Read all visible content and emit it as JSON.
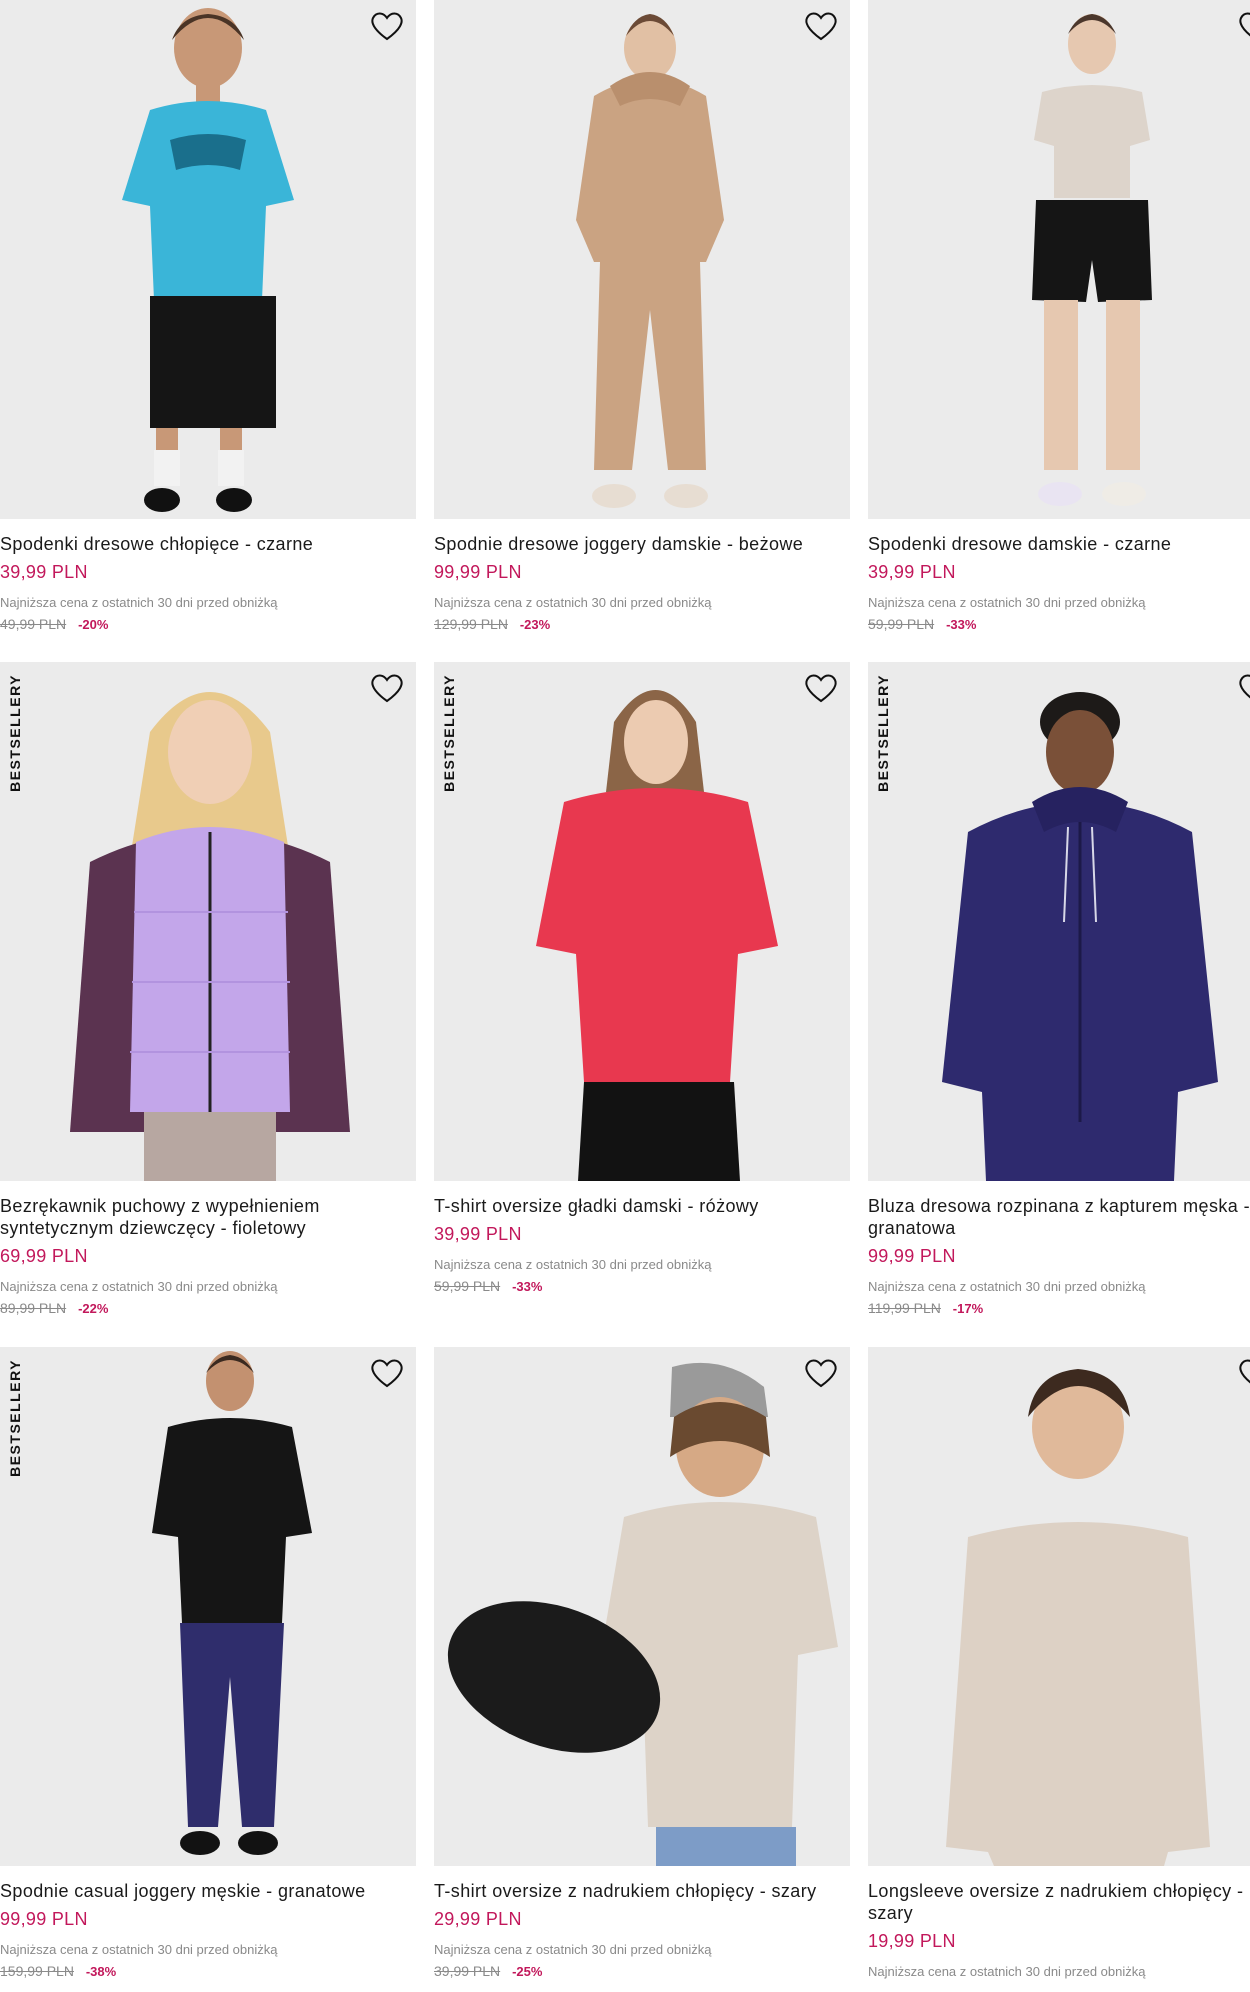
{
  "labels": {
    "lowest_price_note": "Najniższa cena z ostatnich 30 dni przed obniżką",
    "bestseller": "BESTSELLERY"
  },
  "colors": {
    "price": "#c2185b",
    "photo_bg": "#ebebeb"
  },
  "products": [
    {
      "name": "Spodenki dresowe chłopięce - czarne",
      "price": "39,99 PLN",
      "old_price": "49,99 PLN",
      "discount": "-20%",
      "bestseller": false,
      "wishlist_icon": "heart-outline-icon"
    },
    {
      "name": "Spodnie dresowe joggery damskie - beżowe",
      "price": "99,99 PLN",
      "old_price": "129,99 PLN",
      "discount": "-23%",
      "bestseller": false,
      "wishlist_icon": "heart-outline-icon"
    },
    {
      "name": "Spodenki dresowe damskie - czarne",
      "price": "39,99 PLN",
      "old_price": "59,99 PLN",
      "discount": "-33%",
      "bestseller": false,
      "wishlist_icon": "heart-outline-icon"
    },
    {
      "name": "Bezrękawnik puchowy z wypełnieniem syntetycznym dziewczęcy - fioletowy",
      "price": "69,99 PLN",
      "old_price": "89,99 PLN",
      "discount": "-22%",
      "bestseller": true,
      "wishlist_icon": "heart-outline-icon"
    },
    {
      "name": "T-shirt oversize gładki damski - różowy",
      "price": "39,99 PLN",
      "old_price": "59,99 PLN",
      "discount": "-33%",
      "bestseller": true,
      "wishlist_icon": "heart-outline-icon"
    },
    {
      "name": "Bluza dresowa rozpinana z kapturem męska - granatowa",
      "price": "99,99 PLN",
      "old_price": "119,99 PLN",
      "discount": "-17%",
      "bestseller": true,
      "wishlist_icon": "heart-outline-icon"
    },
    {
      "name": "Spodnie casual joggery męskie - granatowe",
      "price": "99,99 PLN",
      "old_price": "159,99 PLN",
      "discount": "-38%",
      "bestseller": true,
      "wishlist_icon": "heart-outline-icon"
    },
    {
      "name": "T-shirt oversize z nadrukiem chłopięcy - szary",
      "price": "29,99 PLN",
      "old_price": "39,99 PLN",
      "discount": "-25%",
      "bestseller": false,
      "wishlist_icon": "heart-outline-icon"
    },
    {
      "name": "Longsleeve oversize z nadrukiem chłopięcy - szary",
      "price": "19,99 PLN",
      "old_price": "",
      "discount": "",
      "bestseller": false,
      "wishlist_icon": "heart-outline-icon"
    }
  ]
}
